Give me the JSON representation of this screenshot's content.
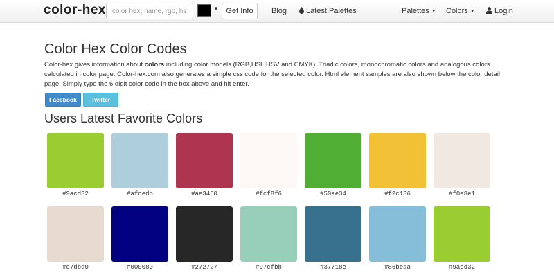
{
  "navbar": {
    "brand": "color-hex",
    "search_placeholder": "color hex, name, rgb, hsl or",
    "picker_color": "#000000",
    "get_info": "Get Info",
    "blog": "Blog",
    "latest_palettes": "Latest Palettes",
    "palettes": "Palettes",
    "colors": "Colors",
    "login": "Login"
  },
  "page": {
    "title": "Color Hex Color Codes",
    "intro_before": "Color-hex gives information about ",
    "intro_bold": "colors",
    "intro_after": " including color models (RGB,HSL,HSV and CMYK), Triadic colors, monochromatic colors and analogous colors calculated in color page. Color-hex.com also generates a simple css code for the selected color. Html element samples are also shown below the color detail page. Simply type the 6 digit color code in the box above and hit enter.",
    "facebook": "Facebook",
    "twitter": "Twitter",
    "subtitle": "Users Latest Favorite Colors"
  },
  "colors": [
    {
      "hex": "#9acd32",
      "label": "#9acd32"
    },
    {
      "hex": "#afcedb",
      "label": "#afcedb"
    },
    {
      "hex": "#ae3450",
      "label": "#ae3450"
    },
    {
      "hex": "#fcf8f6",
      "label": "#fcf8f6"
    },
    {
      "hex": "#50ae34",
      "label": "#50ae34"
    },
    {
      "hex": "#f2c136",
      "label": "#f2c136"
    },
    {
      "hex": "#f0e8e1",
      "label": "#f0e8e1"
    },
    {
      "hex": "#e7dbd0",
      "label": "#e7dbd0"
    },
    {
      "hex": "#000080",
      "label": "#000080"
    },
    {
      "hex": "#272727",
      "label": "#272727"
    },
    {
      "hex": "#97cfbb",
      "label": "#97cfbb"
    },
    {
      "hex": "#37718e",
      "label": "#37718e"
    },
    {
      "hex": "#86beda",
      "label": "#86beda"
    },
    {
      "hex": "#9acd32",
      "label": "#9acd32"
    }
  ]
}
